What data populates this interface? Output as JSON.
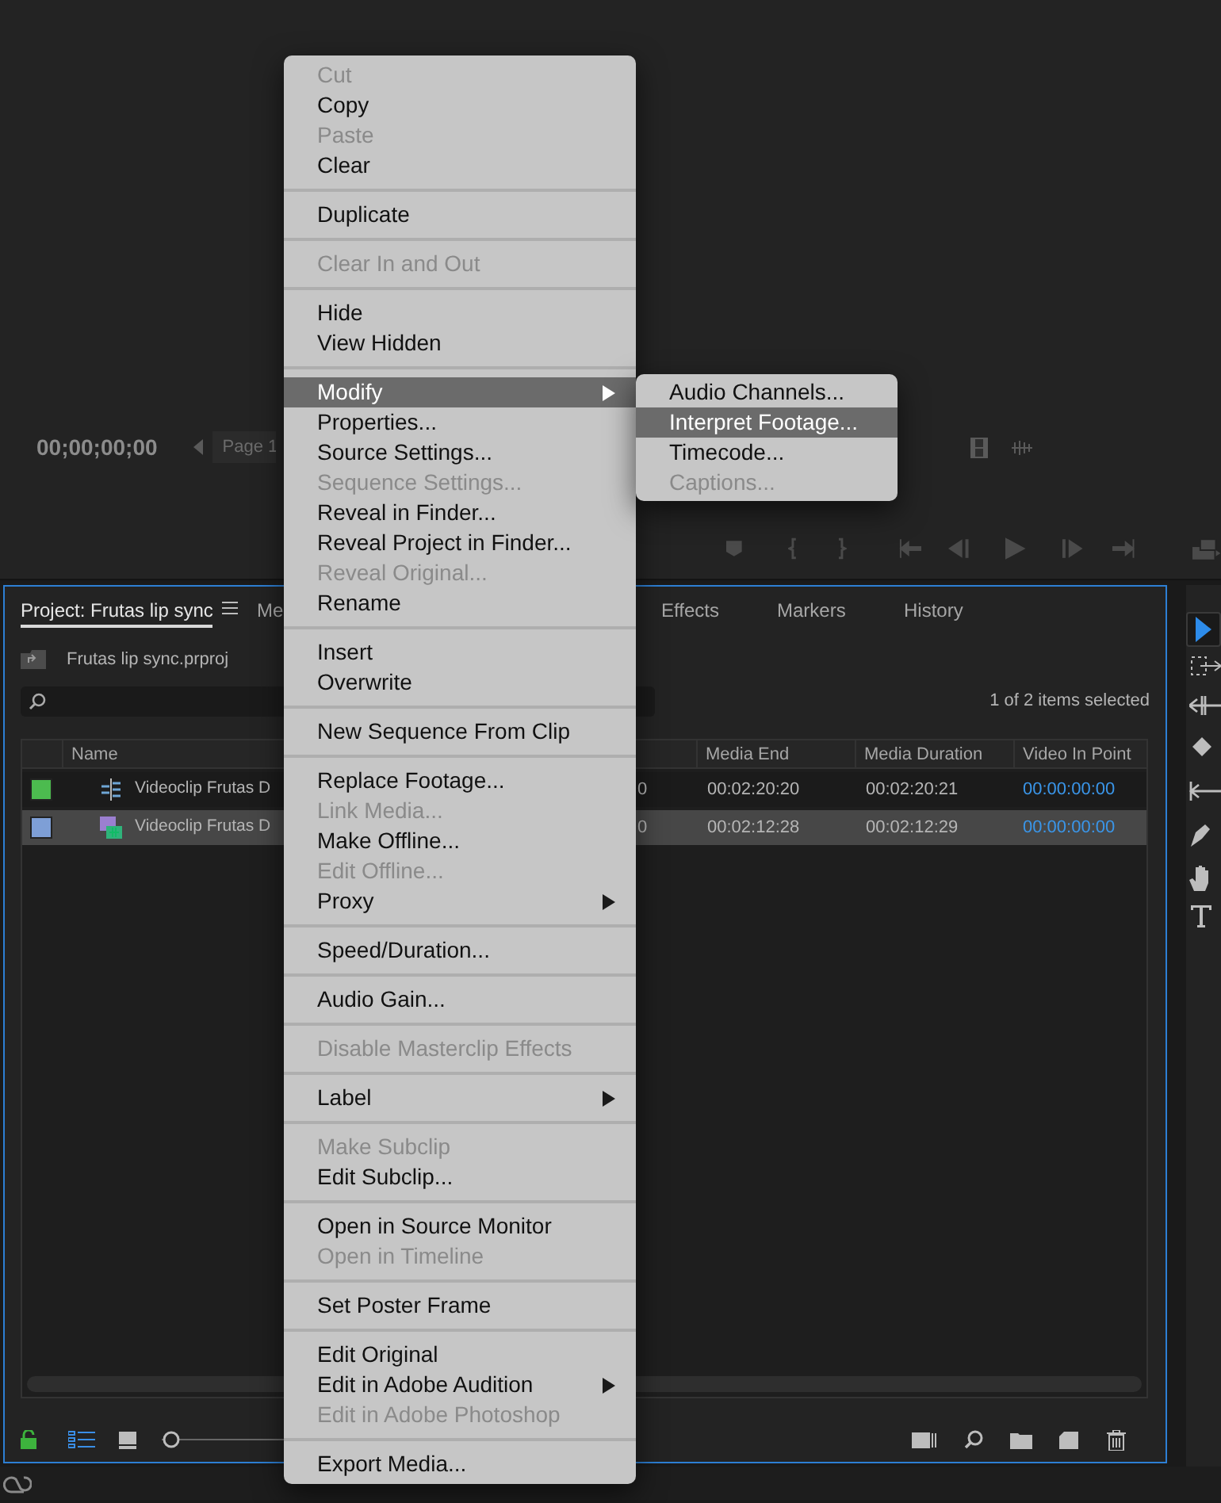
{
  "monitor": {
    "timecode": "00;00;00;00",
    "page_label": "Page 1"
  },
  "project_panel": {
    "tabs": [
      {
        "label": "Project: Frutas lip sync",
        "selected": true
      },
      {
        "label": "Me",
        "selected": false
      },
      {
        "label": "Effects",
        "selected": false
      },
      {
        "label": "Markers",
        "selected": false
      },
      {
        "label": "History",
        "selected": false
      }
    ],
    "file_name": "Frutas lip sync.prproj",
    "selection_status": "1 of 2 items selected",
    "zoom_slider": {
      "level": 0
    },
    "table": {
      "columns": [
        "Name",
        "Media End",
        "Media Duration",
        "Video In Point"
      ],
      "rows": [
        {
          "color": "#4cbb4f",
          "kind": "sequence",
          "name": "Videoclip Frutas D",
          "column_3": "0",
          "media_end": "00:02:20:20",
          "media_duration": "00:02:20:21",
          "video_in_point": "00:00:00:00",
          "selected": false
        },
        {
          "color": "#7e9fd6",
          "kind": "clip",
          "name": "Videoclip Frutas D",
          "column_3": "0",
          "media_end": "00:02:12:28",
          "media_duration": "00:02:12:29",
          "video_in_point": "00:00:00:00",
          "selected": true
        }
      ]
    }
  },
  "context_menu": [
    {
      "kind": "item",
      "label": "Cut",
      "disabled": true,
      "highlighted": false,
      "submenu": false
    },
    {
      "kind": "item",
      "label": "Copy",
      "disabled": false,
      "highlighted": false,
      "submenu": false
    },
    {
      "kind": "item",
      "label": "Paste",
      "disabled": true,
      "highlighted": false,
      "submenu": false
    },
    {
      "kind": "item",
      "label": "Clear",
      "disabled": false,
      "highlighted": false,
      "submenu": false
    },
    {
      "kind": "separator"
    },
    {
      "kind": "item",
      "label": "Duplicate",
      "disabled": false,
      "highlighted": false,
      "submenu": false
    },
    {
      "kind": "separator"
    },
    {
      "kind": "item",
      "label": "Clear In and Out",
      "disabled": true,
      "highlighted": false,
      "submenu": false
    },
    {
      "kind": "separator"
    },
    {
      "kind": "item",
      "label": "Hide",
      "disabled": false,
      "highlighted": false,
      "submenu": false
    },
    {
      "kind": "item",
      "label": "View Hidden",
      "disabled": false,
      "highlighted": false,
      "submenu": false
    },
    {
      "kind": "separator"
    },
    {
      "kind": "item",
      "label": "Modify",
      "disabled": false,
      "highlighted": true,
      "submenu": true
    },
    {
      "kind": "item",
      "label": "Properties...",
      "disabled": false,
      "highlighted": false,
      "submenu": false
    },
    {
      "kind": "item",
      "label": "Source Settings...",
      "disabled": false,
      "highlighted": false,
      "submenu": false
    },
    {
      "kind": "item",
      "label": "Sequence Settings...",
      "disabled": true,
      "highlighted": false,
      "submenu": false
    },
    {
      "kind": "item",
      "label": "Reveal in Finder...",
      "disabled": false,
      "highlighted": false,
      "submenu": false
    },
    {
      "kind": "item",
      "label": "Reveal Project in Finder...",
      "disabled": false,
      "highlighted": false,
      "submenu": false
    },
    {
      "kind": "item",
      "label": "Reveal Original...",
      "disabled": true,
      "highlighted": false,
      "submenu": false
    },
    {
      "kind": "item",
      "label": "Rename",
      "disabled": false,
      "highlighted": false,
      "submenu": false
    },
    {
      "kind": "separator"
    },
    {
      "kind": "item",
      "label": "Insert",
      "disabled": false,
      "highlighted": false,
      "submenu": false
    },
    {
      "kind": "item",
      "label": "Overwrite",
      "disabled": false,
      "highlighted": false,
      "submenu": false
    },
    {
      "kind": "separator"
    },
    {
      "kind": "item",
      "label": "New Sequence From Clip",
      "disabled": false,
      "highlighted": false,
      "submenu": false
    },
    {
      "kind": "separator"
    },
    {
      "kind": "item",
      "label": "Replace Footage...",
      "disabled": false,
      "highlighted": false,
      "submenu": false
    },
    {
      "kind": "item",
      "label": "Link Media...",
      "disabled": true,
      "highlighted": false,
      "submenu": false
    },
    {
      "kind": "item",
      "label": "Make Offline...",
      "disabled": false,
      "highlighted": false,
      "submenu": false
    },
    {
      "kind": "item",
      "label": "Edit Offline...",
      "disabled": true,
      "highlighted": false,
      "submenu": false
    },
    {
      "kind": "item",
      "label": "Proxy",
      "disabled": false,
      "highlighted": false,
      "submenu": true
    },
    {
      "kind": "separator"
    },
    {
      "kind": "item",
      "label": "Speed/Duration...",
      "disabled": false,
      "highlighted": false,
      "submenu": false
    },
    {
      "kind": "separator"
    },
    {
      "kind": "item",
      "label": "Audio Gain...",
      "disabled": false,
      "highlighted": false,
      "submenu": false
    },
    {
      "kind": "separator"
    },
    {
      "kind": "item",
      "label": "Disable Masterclip Effects",
      "disabled": true,
      "highlighted": false,
      "submenu": false
    },
    {
      "kind": "separator"
    },
    {
      "kind": "item",
      "label": "Label",
      "disabled": false,
      "highlighted": false,
      "submenu": true
    },
    {
      "kind": "separator"
    },
    {
      "kind": "item",
      "label": "Make Subclip",
      "disabled": true,
      "highlighted": false,
      "submenu": false
    },
    {
      "kind": "item",
      "label": "Edit Subclip...",
      "disabled": false,
      "highlighted": false,
      "submenu": false
    },
    {
      "kind": "separator"
    },
    {
      "kind": "item",
      "label": "Open in Source Monitor",
      "disabled": false,
      "highlighted": false,
      "submenu": false
    },
    {
      "kind": "item",
      "label": "Open in Timeline",
      "disabled": true,
      "highlighted": false,
      "submenu": false
    },
    {
      "kind": "separator"
    },
    {
      "kind": "item",
      "label": "Set Poster Frame",
      "disabled": false,
      "highlighted": false,
      "submenu": false
    },
    {
      "kind": "separator"
    },
    {
      "kind": "item",
      "label": "Edit Original",
      "disabled": false,
      "highlighted": false,
      "submenu": false
    },
    {
      "kind": "item",
      "label": "Edit in Adobe Audition",
      "disabled": false,
      "highlighted": false,
      "submenu": true
    },
    {
      "kind": "item",
      "label": "Edit in Adobe Photoshop",
      "disabled": true,
      "highlighted": false,
      "submenu": false
    },
    {
      "kind": "separator"
    },
    {
      "kind": "item",
      "label": "Export Media...",
      "disabled": false,
      "highlighted": false,
      "submenu": false
    }
  ],
  "submenu": [
    {
      "label": "Audio Channels...",
      "disabled": false,
      "highlighted": false
    },
    {
      "label": "Interpret Footage...",
      "disabled": false,
      "highlighted": true
    },
    {
      "label": "Timecode...",
      "disabled": false,
      "highlighted": false
    },
    {
      "label": "Captions...",
      "disabled": true,
      "highlighted": false
    }
  ]
}
